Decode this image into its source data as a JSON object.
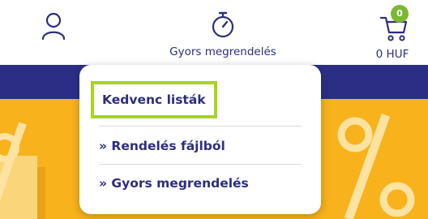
{
  "header": {
    "user_icon": "user-icon",
    "quick_order": {
      "icon": "stopwatch-icon",
      "label": "Gyors megrendelés"
    },
    "cart": {
      "icon": "cart-icon",
      "badge": "0",
      "total": "0 HUF"
    }
  },
  "dropdown": {
    "items": [
      {
        "label": "Kedvenc listák",
        "selected": true
      },
      {
        "label": "» Rendelés fájlból"
      },
      {
        "label": "» Gyors megrendelés"
      }
    ]
  },
  "colors": {
    "brand_navy": "#2c2e86",
    "accent_green": "#7cb932",
    "focus_outline": "#a6d51f",
    "hero_yellow": "#f7b21c"
  }
}
